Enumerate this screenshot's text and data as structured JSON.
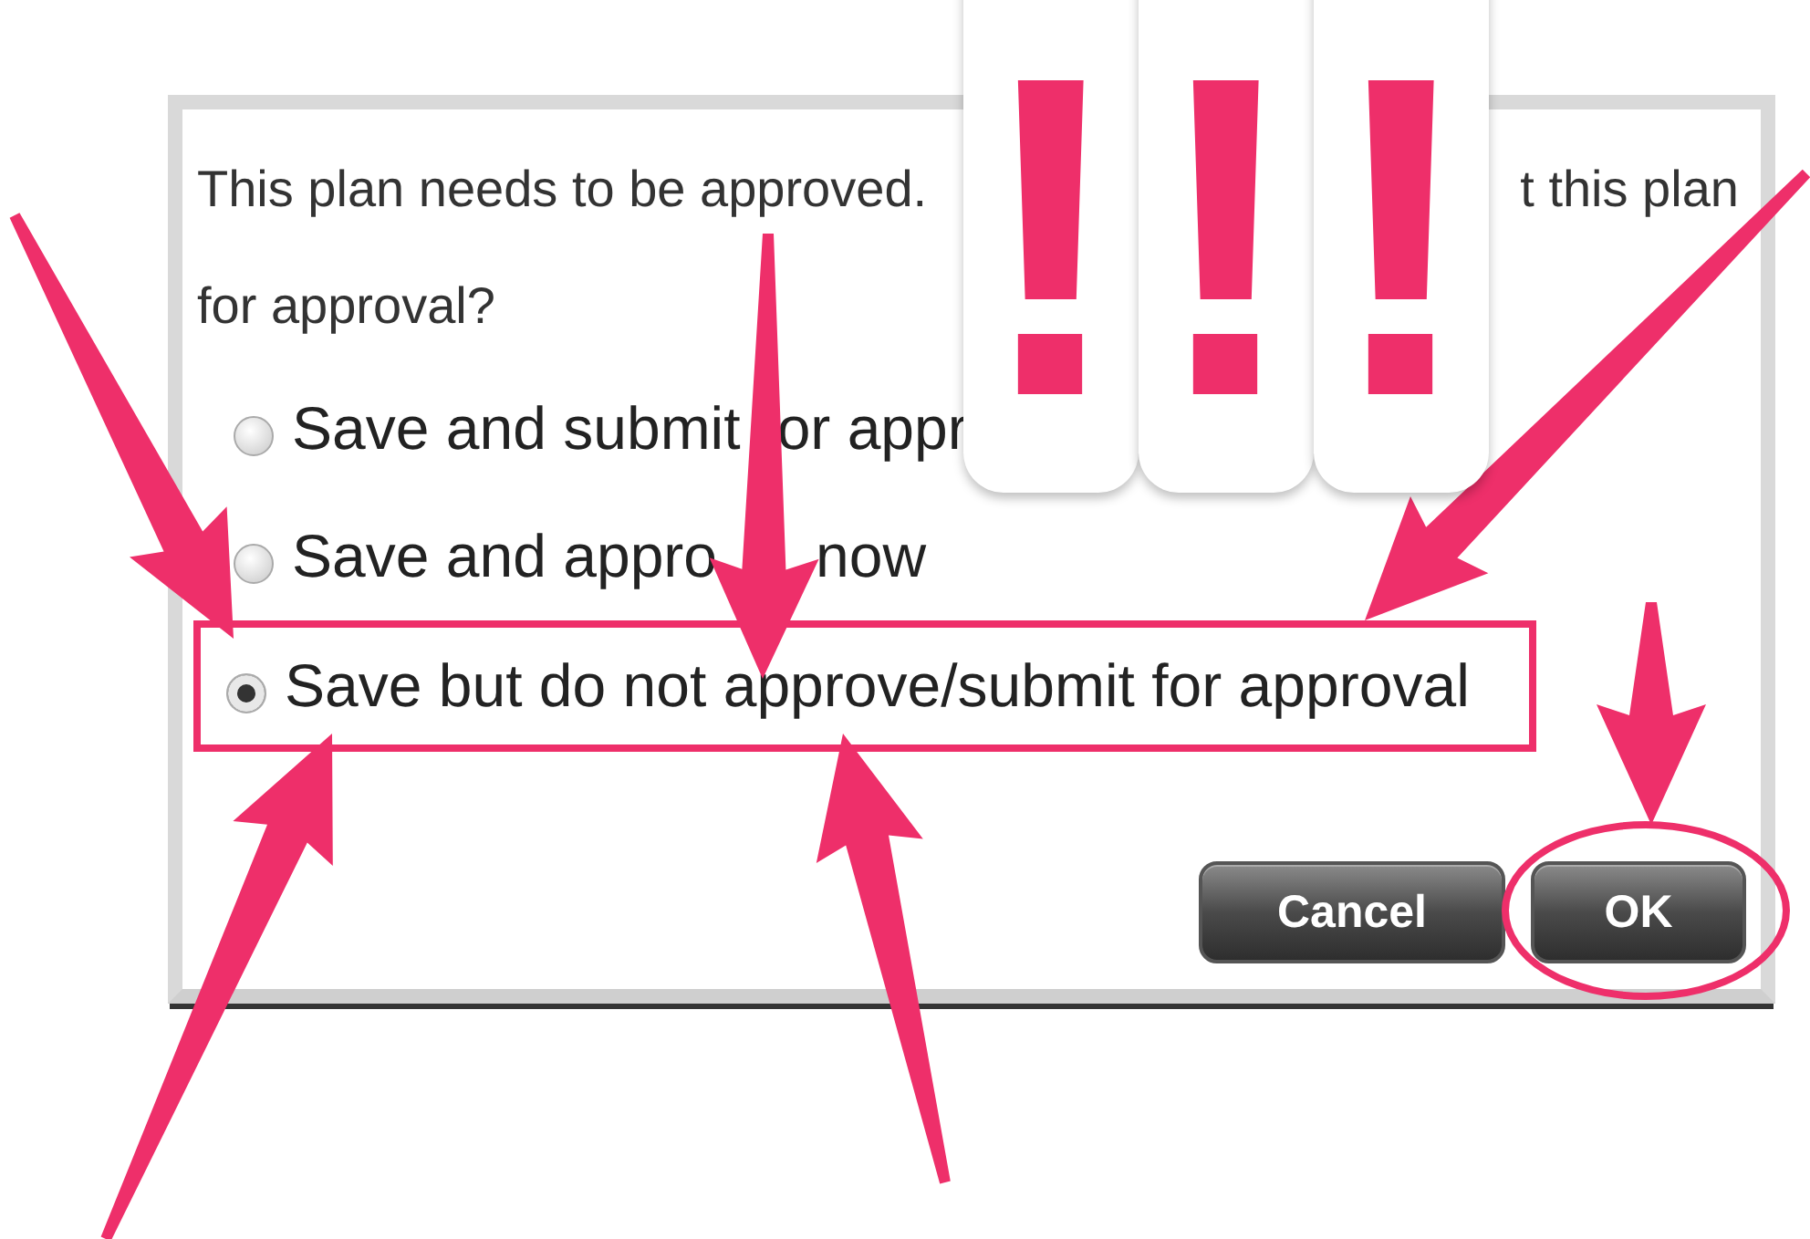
{
  "message_lines": [
    [
      "This plan needs to be approved.",
      "t this plan"
    ],
    [
      "for approval?"
    ]
  ],
  "options": [
    {
      "label_parts": [
        "Save and submit",
        "or appr"
      ],
      "selected": false,
      "highlighted": false
    },
    {
      "label_parts": [
        "Save and appro",
        "now"
      ],
      "selected": false,
      "highlighted": false
    },
    {
      "label_parts": [
        "Save but do not approve/submit for approval"
      ],
      "selected": true,
      "highlighted": true
    }
  ],
  "buttons": [
    {
      "label": "Cancel",
      "highlighted": false
    },
    {
      "label": "OK",
      "highlighted": true
    }
  ],
  "sticker_marks": [
    "!",
    "!",
    "!"
  ]
}
